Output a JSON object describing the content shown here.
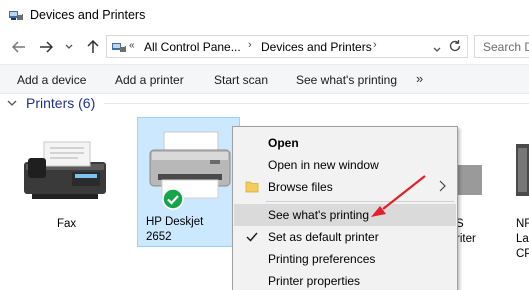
{
  "window": {
    "title": "Devices and Printers",
    "icon": "devices-printers-icon"
  },
  "nav": {
    "back_icon": "back-arrow-icon",
    "forward_icon": "forward-arrow-icon",
    "recent_icon": "chevron-down-icon",
    "up_icon": "up-arrow-icon"
  },
  "address": {
    "overflow": "«",
    "crumbs": [
      "All Control Pane...",
      "Devices and Printers"
    ],
    "refresh_icon": "refresh-icon"
  },
  "search": {
    "placeholder": "Search D"
  },
  "commands": {
    "add_device": "Add a device",
    "add_printer": "Add a printer",
    "start_scan": "Start scan",
    "see_printing": "See what's printing",
    "more": "»"
  },
  "group": {
    "title": "Printers (6)"
  },
  "devices": {
    "fax": "Fax",
    "hp_line1": "HP Deskjet",
    "hp_line2": "2652",
    "partial_1_line1": "S",
    "partial_1_line2": "riter",
    "partial_2_line1": "NF",
    "partial_2_line2": "La",
    "partial_2_line3": "CP"
  },
  "menu": {
    "open": "Open",
    "open_new_window": "Open in new window",
    "browse_files": "Browse files",
    "see_printing": "See what's printing",
    "set_default": "Set as default printer",
    "printing_prefs": "Printing preferences",
    "printer_props": "Printer properties"
  },
  "colors": {
    "accent": "#1e3287",
    "selection": "#cce8ff",
    "default_check": "#16a34a",
    "annotation_arrow": "#e0212b"
  }
}
